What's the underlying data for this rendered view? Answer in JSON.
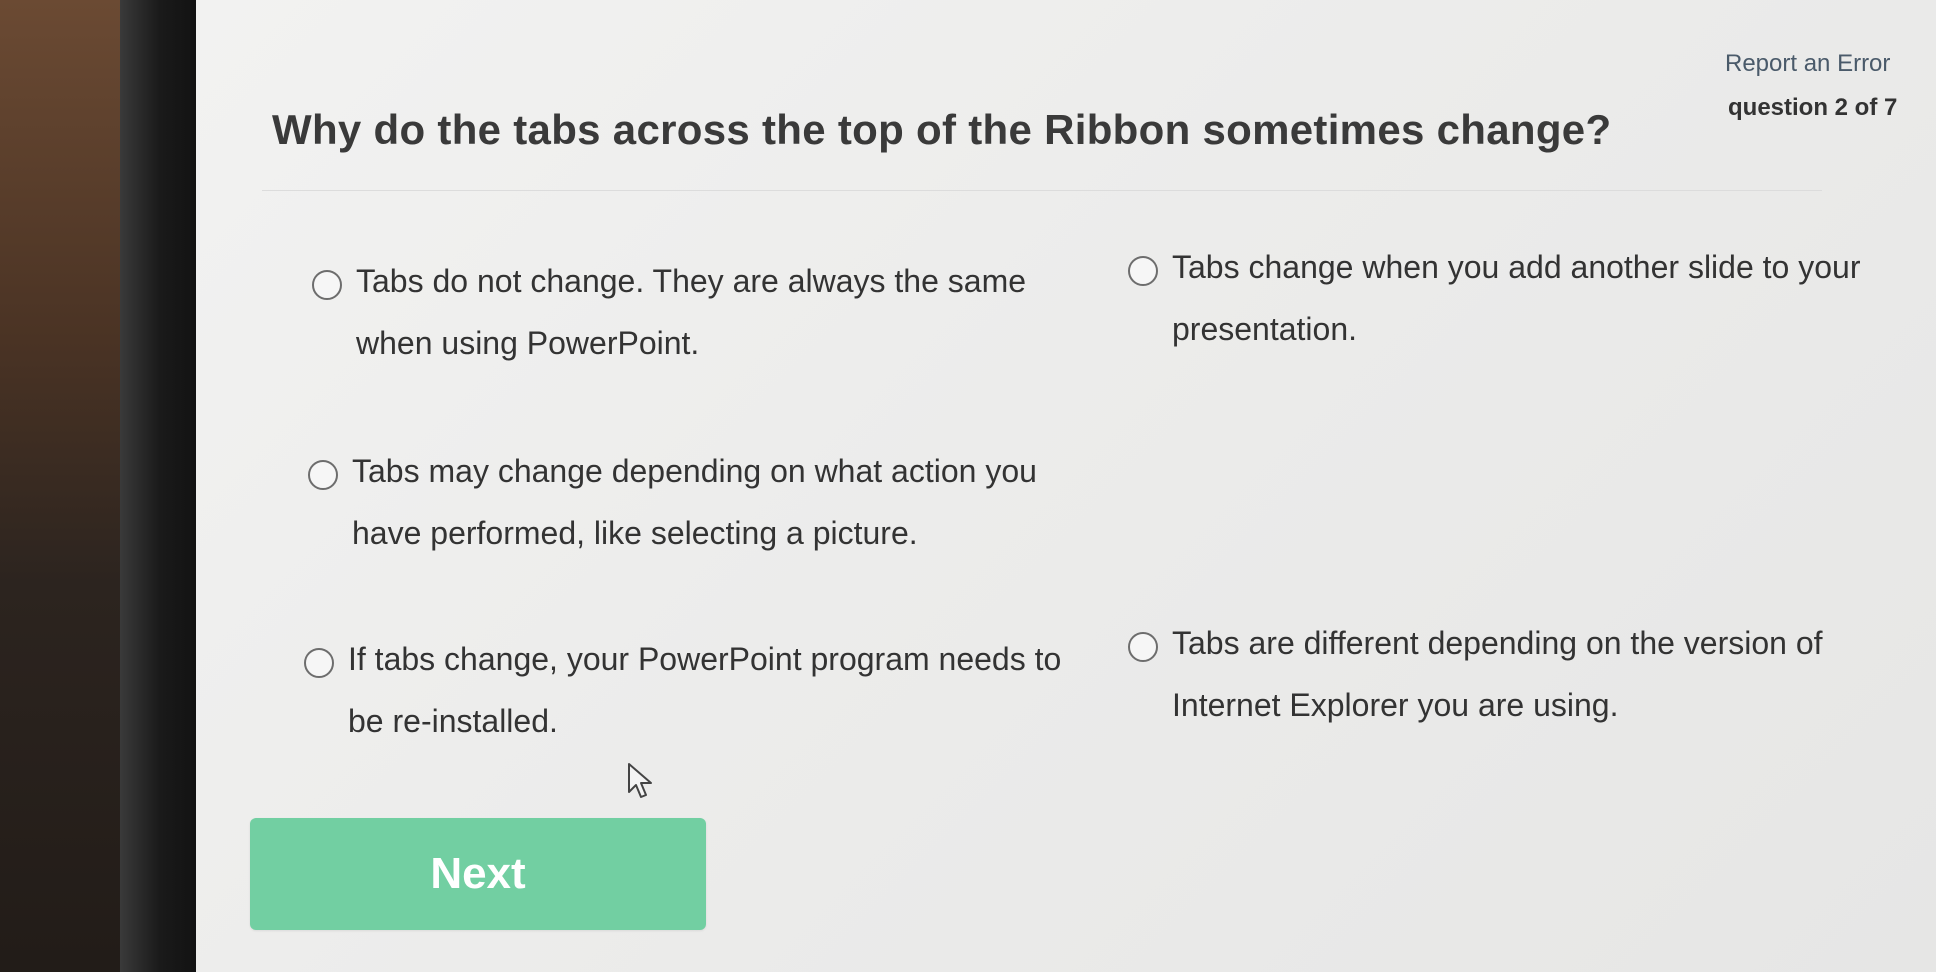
{
  "header": {
    "report_link": "Report an Error",
    "question_count": "question 2 of 7"
  },
  "question": {
    "title": "Why do the tabs across the top of the Ribbon sometimes change?"
  },
  "options": [
    {
      "label": "Tabs do not change. They are always the same when using PowerPoint.",
      "selected": false
    },
    {
      "label": "Tabs change when you add another slide to your presentation.",
      "selected": false
    },
    {
      "label": "Tabs may change depending on what action you have performed, like selecting a picture.",
      "selected": false
    },
    {
      "label": "If tabs change, your PowerPoint program needs to be re-installed.",
      "selected": false
    },
    {
      "label": "Tabs are different depending on the version of Internet Explorer you are using.",
      "selected": false
    }
  ],
  "footer": {
    "next_label": "Next"
  },
  "colors": {
    "accent": "#72cfa2",
    "text": "#333333",
    "link": "#4a5a6a"
  },
  "icons": {
    "radio": "radio-button-empty-icon",
    "cursor": "mouse-pointer-icon"
  }
}
